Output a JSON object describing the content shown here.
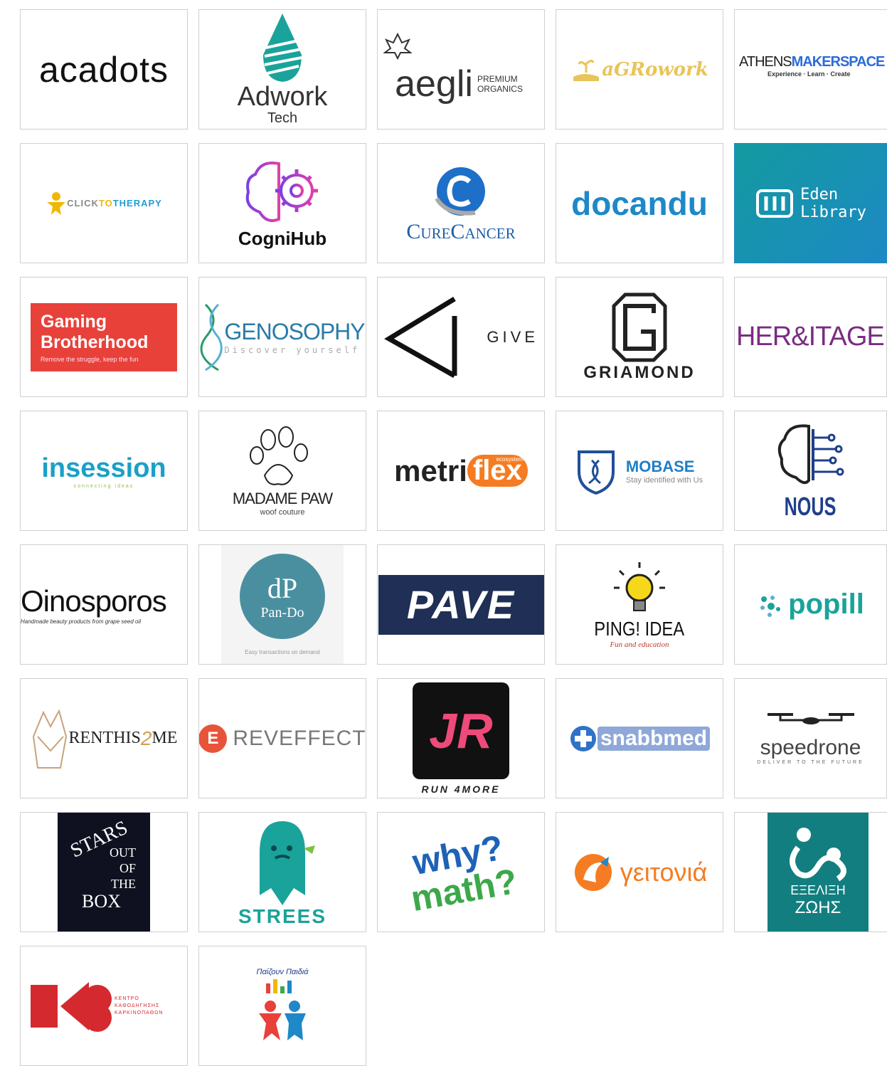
{
  "colors": {
    "teal": "#1aa39a",
    "blue": "#1e88c8",
    "red": "#e8413a",
    "purple": "#7a2c82",
    "navy": "#1f2f55",
    "gold": "#e8c45a",
    "orange": "#f57c22",
    "green": "#7cc143"
  },
  "logos": [
    {
      "name": "acadots",
      "text": "acadots"
    },
    {
      "name": "adwork-tech",
      "text": "Adwork",
      "sub": "Tech"
    },
    {
      "name": "aegli",
      "text": "aegli",
      "sub": "PREMIUM ORGANICS"
    },
    {
      "name": "agrowork",
      "text": "aGRowork"
    },
    {
      "name": "athens-makerspace",
      "text_a": "ATHENS",
      "text_b": "MAKERSPACE",
      "sub": "Experience · Learn · Create"
    },
    {
      "name": "click-to-therapy",
      "text_a": "CLICK",
      "text_b": "TO",
      "text_c": "THERAPY"
    },
    {
      "name": "cognihub",
      "text": "CogniHub"
    },
    {
      "name": "curecancer",
      "text": "CureCancer"
    },
    {
      "name": "docandu",
      "text": "docandu"
    },
    {
      "name": "eden-library",
      "text_a": "Eden",
      "text_b": "Library"
    },
    {
      "name": "gaming-brotherhood",
      "text_a": "Gaming",
      "text_b": "Brotherhood",
      "sub": "Remove the struggle, keep the fun"
    },
    {
      "name": "genosophy",
      "text": "GENOSOPHY",
      "sub": "Discover yourself"
    },
    {
      "name": "give",
      "text": "GIVE"
    },
    {
      "name": "griamond",
      "text": "GRIAMOND"
    },
    {
      "name": "heritage",
      "text": "HER&ITAGE"
    },
    {
      "name": "insession",
      "text": "insession",
      "sub": "connecting ideas"
    },
    {
      "name": "madame-paw",
      "text": "MADAME PAW",
      "sub": "woof couture"
    },
    {
      "name": "metriflex",
      "text_a": "metri",
      "text_b": "flex",
      "sub": "ecosystem"
    },
    {
      "name": "mobase",
      "text": "MOBASE",
      "sub": "Stay identified with Us"
    },
    {
      "name": "nous",
      "text": "NOUS"
    },
    {
      "name": "oinosporos",
      "text": "Oinosporos",
      "sub": "Handmade beauty products from grape seed oil"
    },
    {
      "name": "pan-do",
      "mono": "dP",
      "text": "Pan-Do",
      "sub": "Easy transactions on demand"
    },
    {
      "name": "pave",
      "text": "PAVE"
    },
    {
      "name": "ping-idea",
      "text": "PING! IDEA",
      "sub": "Fun and education"
    },
    {
      "name": "popill",
      "text": "popill"
    },
    {
      "name": "renthis2me",
      "text_a": "RENTHIS",
      "text_b": "2",
      "text_c": "ME"
    },
    {
      "name": "reveffect",
      "mono": "E",
      "text": "REVEFFECT"
    },
    {
      "name": "run4more",
      "mono": "JR",
      "text": "RUN 4MORE"
    },
    {
      "name": "snabbmed",
      "text": "snabbmed"
    },
    {
      "name": "speedrone",
      "text": "speedrone",
      "sub": "DELIVER TO THE FUTURE"
    },
    {
      "name": "stars-out-of-the-box",
      "text_a": "STARS",
      "text_b": "OUT",
      "text_c": "OF",
      "text_d": "THE",
      "text_e": "BOX"
    },
    {
      "name": "strees",
      "text": "STREES"
    },
    {
      "name": "why-math",
      "text_a": "why?",
      "text_b": "math?"
    },
    {
      "name": "geitonia",
      "text": "γειτονιά"
    },
    {
      "name": "exelixi-zois",
      "text_a": "ΕΞΕΛΙΞΗ",
      "text_b": "ΖΩΗΣ"
    },
    {
      "name": "kentro-kathodigisis",
      "text": "ΚΕΝΤΡΟ ΚΑΘΟΔΗΓΗΣΗΣ ΚΑΡΚΙΝΟΠΑΘΩΝ"
    },
    {
      "name": "paizoun-paidia",
      "text": "Παίζουν Παιδιά"
    }
  ]
}
